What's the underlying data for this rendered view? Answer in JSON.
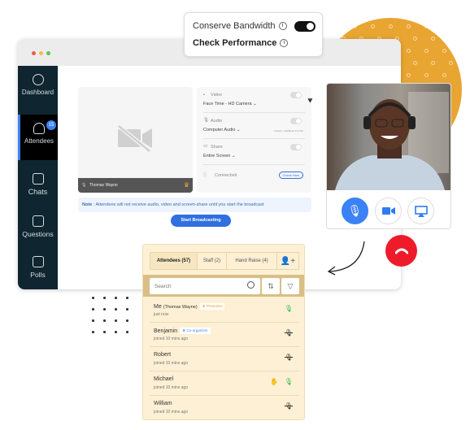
{
  "popup": {
    "conserve_bandwidth": "Conserve Bandwidth",
    "check_performance": "Check Performance",
    "conserve_bandwidth_on": true,
    "info_icon": "i"
  },
  "sidebar": {
    "items": [
      {
        "label": "Dashboard",
        "icon": "pie-chart-icon"
      },
      {
        "label": "Attendees",
        "icon": "users-icon",
        "badge": "15"
      },
      {
        "label": "Chats",
        "icon": "chat-icon"
      },
      {
        "label": "Questions",
        "icon": "question-icon"
      },
      {
        "label": "Polls",
        "icon": "poll-icon"
      }
    ]
  },
  "preview": {
    "name": "Thomas Wayne"
  },
  "settings": {
    "video": {
      "label": "Video",
      "device": "Face Time - HD Camera"
    },
    "audio": {
      "label": "Audio",
      "device": "Computer Audio",
      "hint": "Default - MacBook Pro Mic"
    },
    "share": {
      "label": "Share",
      "device": "Entire Screen"
    },
    "connectivity": {
      "label": "Connectivit",
      "button": "Check Now"
    }
  },
  "note": {
    "prefix": "Note",
    "text": " : Attendees will not receive audio, video and screen-share until you start the broadcast"
  },
  "start_button": "Start Broadcasting",
  "panel": {
    "tabs": [
      "Attendees (57)",
      "Staff (2)",
      "Hand Raise (4)"
    ],
    "search_placeholder": "Search",
    "attendees": [
      {
        "name": "Me",
        "sub": "(Thomas Wayne)",
        "tag": "Presenter",
        "time": "just now",
        "mic": "on"
      },
      {
        "name": "Benjamin",
        "tag": "Co-organizer",
        "time": "joined 10 mins ago",
        "mic": "muted"
      },
      {
        "name": "Robert",
        "time": "joined 10 mins ago",
        "mic": "muted"
      },
      {
        "name": "Michael",
        "time": "joined 10 mins ago",
        "mic": "on",
        "hand_raised": true
      },
      {
        "name": "William",
        "time": "joined 10 mins ago",
        "mic": "muted"
      }
    ]
  },
  "colors": {
    "accent": "#2f6fe0",
    "orange": "#e9a531",
    "end_call": "#ee1c2a",
    "sidebar": "#0f2530",
    "panel": "#fdf0d4"
  }
}
